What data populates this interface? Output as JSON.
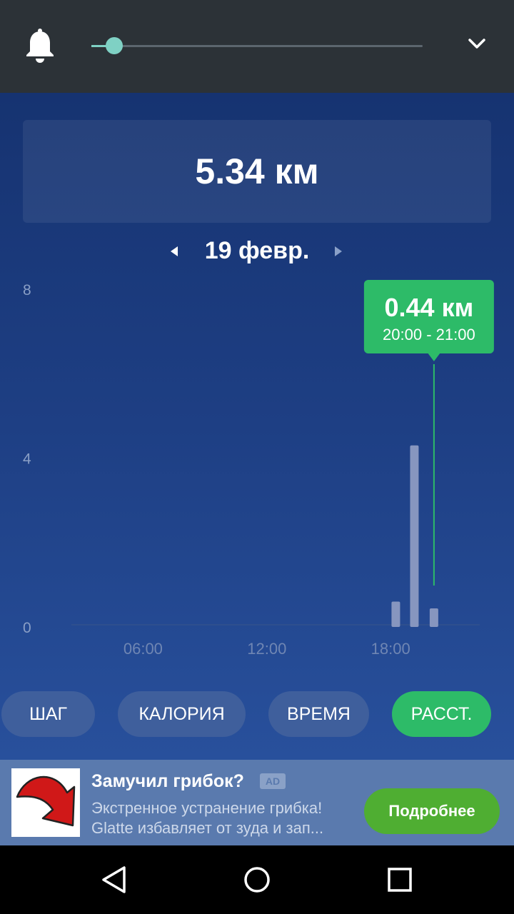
{
  "toolbar": {
    "bell_icon": "bell-icon",
    "slider_value": 0.07,
    "chevron_icon": "chevron-down-icon",
    "accent": "#7fd1c4"
  },
  "summary": {
    "total": "5.34 км"
  },
  "date_nav": {
    "label": "19 февр.",
    "prev_icon": "triangle-left-icon",
    "next_icon": "triangle-right-icon"
  },
  "chart_data": {
    "type": "bar",
    "y_ticks": [
      "8",
      "4",
      "0"
    ],
    "x_ticks": [
      "06:00",
      "12:00",
      "18:00"
    ],
    "ylim": [
      0,
      8
    ],
    "xlim": [
      0,
      24
    ],
    "x": [
      18.25,
      19.15,
      20.1
    ],
    "values": [
      0.6,
      4.3,
      0.44
    ],
    "tooltip": {
      "value": "0.44 км",
      "range": "20:00 - 21:00",
      "x": 20.1,
      "color": "#2dbb68"
    }
  },
  "tabs": [
    {
      "label": "ШАГ",
      "active": false
    },
    {
      "label": "КАЛОРИЯ",
      "active": false
    },
    {
      "label": "ВРЕМЯ",
      "active": false
    },
    {
      "label": "РАССТ.",
      "active": true
    }
  ],
  "ad": {
    "title": "Замучил грибок?",
    "badge": "AD",
    "line1": "Экстренное устранение грибка!",
    "line2": "Glatte избавляет от зуда и зап...",
    "cta": "Подробнее"
  },
  "navbar": {
    "back_icon": "back-triangle-icon",
    "home_icon": "home-circle-icon",
    "recents_icon": "recents-square-icon"
  }
}
